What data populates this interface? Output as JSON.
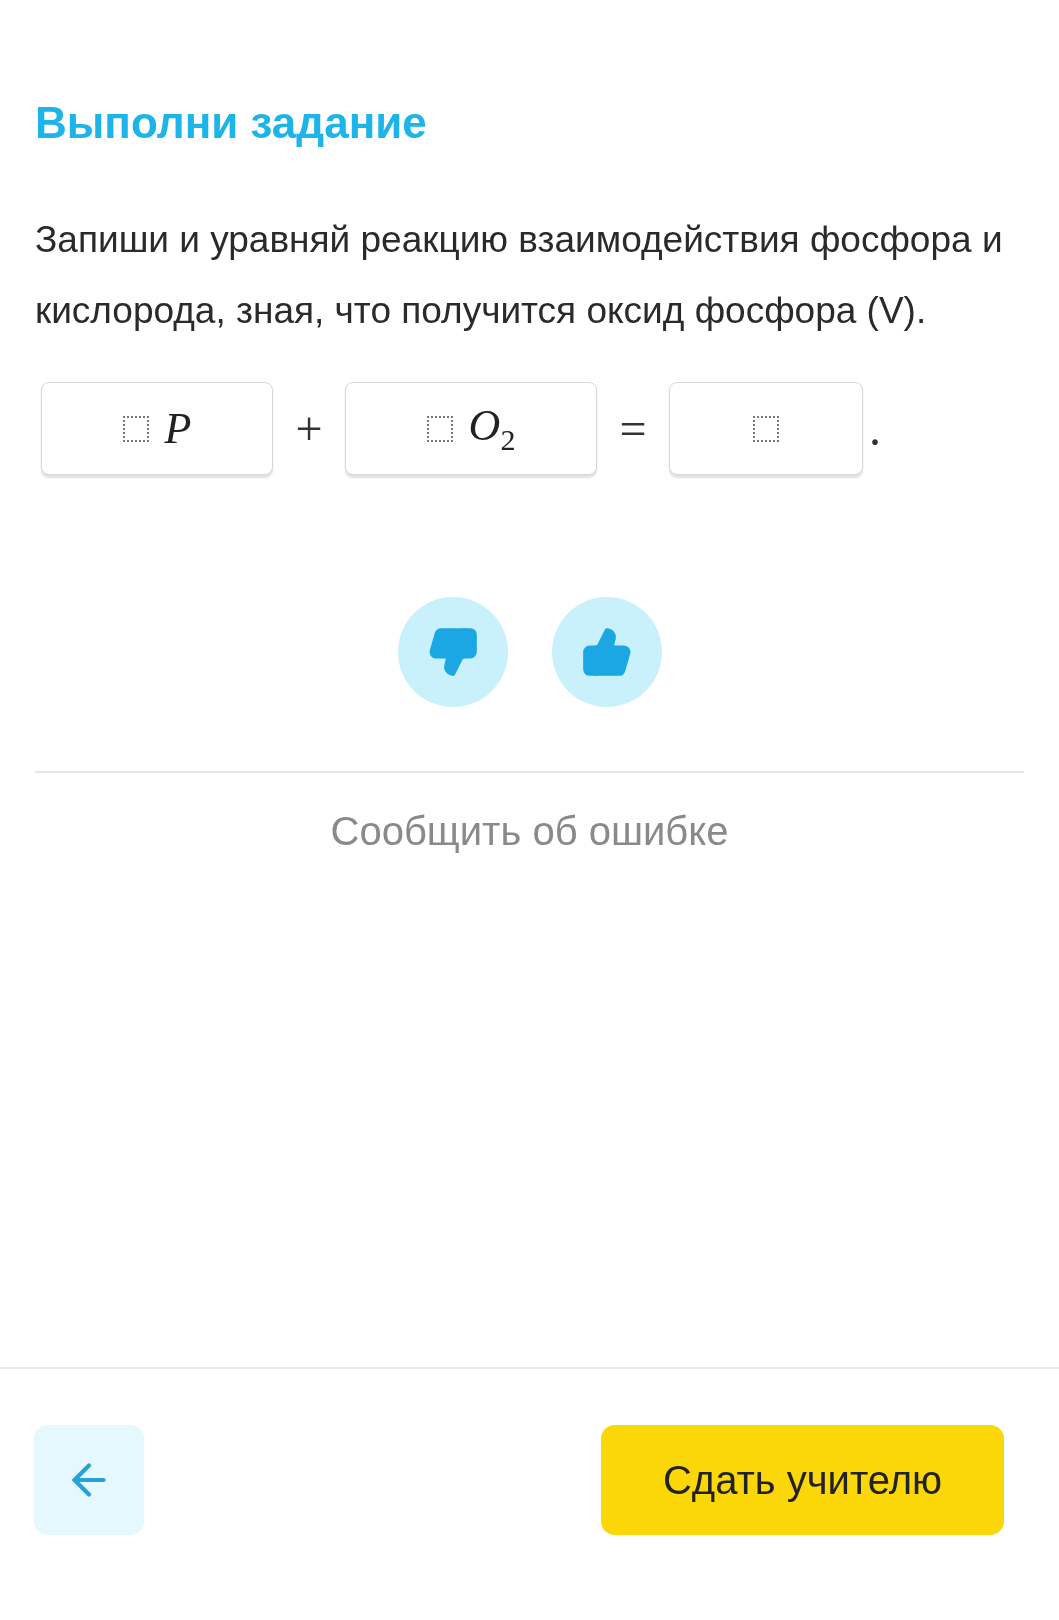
{
  "header": {
    "title": "Выполни задание"
  },
  "task": {
    "text": "Запиши и уравняй реакцию взаимодействия фосфора и кислорода, зная, что получится оксид фосфора (V)."
  },
  "equation": [
    {
      "kind": "field",
      "formula": "P"
    },
    {
      "kind": "operator",
      "symbol": "+"
    },
    {
      "kind": "field",
      "formula": "O$_{2}$"
    },
    {
      "kind": "operator",
      "symbol": "="
    },
    {
      "kind": "field"
    },
    {
      "kind": "operator",
      "symbol": "."
    }
  ],
  "feedback": [
    {
      "kind": "dislike"
    },
    {
      "kind": "like"
    }
  ],
  "report": {
    "label": "Сообщить об ошибке"
  },
  "footer": {
    "submit": "Сдать учителю"
  }
}
